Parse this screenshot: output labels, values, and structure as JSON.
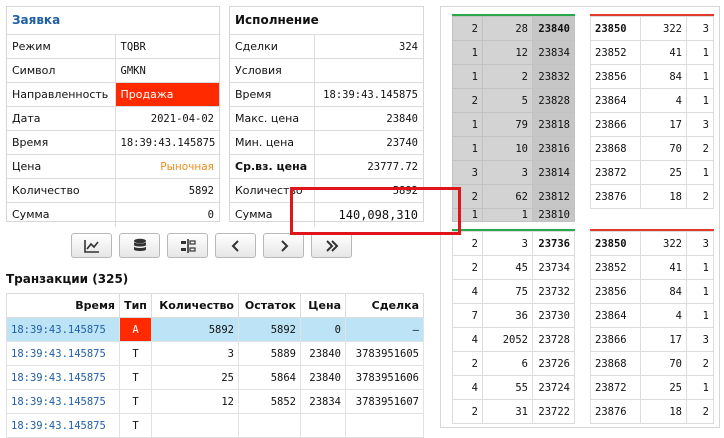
{
  "order": {
    "title": "Заявка",
    "rows": [
      {
        "label": "Режим",
        "value": "TQBR"
      },
      {
        "label": "Символ",
        "value": "GMKN"
      },
      {
        "label": "Направленность",
        "value": "Продажа"
      },
      {
        "label": "Дата",
        "value": "2021-04-02"
      },
      {
        "label": "Время",
        "value": "18:39:43.145875"
      },
      {
        "label": "Цена",
        "value": "Рыночная"
      },
      {
        "label": "Количество",
        "value": "5892"
      },
      {
        "label": "Сумма",
        "value": "0"
      }
    ]
  },
  "execution": {
    "title": "Исполнение",
    "rows": [
      {
        "label": "Сделки",
        "value": "324"
      },
      {
        "label": "Условия",
        "value": ""
      },
      {
        "label": "Время",
        "value": "18:39:43.145875"
      },
      {
        "label": "Макс. цена",
        "value": "23840"
      },
      {
        "label": "Мин. цена",
        "value": "23740"
      },
      {
        "label": "Ср.вз. цена",
        "value": "23777.72"
      },
      {
        "label": "Количество",
        "value": "5892"
      },
      {
        "label": "Сумма",
        "value": "140,098,310"
      }
    ]
  },
  "toolbar": {
    "buttons": [
      {
        "name": "chart-button",
        "icon": "line-chart-icon"
      },
      {
        "name": "database-button",
        "icon": "database-icon"
      },
      {
        "name": "split-button",
        "icon": "split-columns-icon"
      },
      {
        "name": "prev-button",
        "icon": "chevron-left-icon"
      },
      {
        "name": "next-button",
        "icon": "chevron-right-icon"
      },
      {
        "name": "last-button",
        "icon": "double-chevron-right-icon"
      }
    ]
  },
  "transactions": {
    "title": "Транзакции (325)",
    "columns": [
      "Время",
      "Тип",
      "Количество",
      "Остаток",
      "Цена",
      "Сделка"
    ],
    "rows": [
      [
        "18:39:43.145875",
        "A",
        "5892",
        "5892",
        "0",
        "–"
      ],
      [
        "18:39:43.145875",
        "T",
        "3",
        "5889",
        "23840",
        "3783951605"
      ],
      [
        "18:39:43.145875",
        "T",
        "25",
        "5864",
        "23840",
        "3783951606"
      ],
      [
        "18:39:43.145875",
        "T",
        "12",
        "5852",
        "23834",
        "3783951607"
      ],
      [
        "18:39:43.145875",
        "T",
        "",
        "",
        "",
        ""
      ]
    ]
  },
  "book_top_left": {
    "rows": [
      [
        "2",
        "28",
        "23840"
      ],
      [
        "1",
        "12",
        "23834"
      ],
      [
        "1",
        "2",
        "23832"
      ],
      [
        "2",
        "5",
        "23828"
      ],
      [
        "1",
        "79",
        "23818"
      ],
      [
        "1",
        "10",
        "23816"
      ],
      [
        "3",
        "3",
        "23814"
      ],
      [
        "2",
        "62",
        "23812"
      ],
      [
        "1",
        "1",
        "23810"
      ]
    ]
  },
  "book_top_right": {
    "rows": [
      [
        "23850",
        "322",
        "3"
      ],
      [
        "23852",
        "41",
        "1"
      ],
      [
        "23856",
        "84",
        "1"
      ],
      [
        "23864",
        "4",
        "1"
      ],
      [
        "23866",
        "17",
        "3"
      ],
      [
        "23868",
        "70",
        "2"
      ],
      [
        "23872",
        "25",
        "1"
      ],
      [
        "23876",
        "18",
        "2"
      ]
    ]
  },
  "book_bottom_left": {
    "rows": [
      [
        "2",
        "3",
        "23736"
      ],
      [
        "2",
        "45",
        "23734"
      ],
      [
        "4",
        "75",
        "23732"
      ],
      [
        "7",
        "36",
        "23730"
      ],
      [
        "4",
        "2052",
        "23728"
      ],
      [
        "2",
        "6",
        "23726"
      ],
      [
        "4",
        "55",
        "23724"
      ],
      [
        "2",
        "31",
        "23722"
      ]
    ]
  },
  "book_bottom_right": {
    "rows": [
      [
        "23850",
        "322",
        "3"
      ],
      [
        "23852",
        "41",
        "1"
      ],
      [
        "23856",
        "84",
        "1"
      ],
      [
        "23864",
        "4",
        "1"
      ],
      [
        "23866",
        "17",
        "3"
      ],
      [
        "23868",
        "70",
        "2"
      ],
      [
        "23872",
        "25",
        "1"
      ],
      [
        "23876",
        "18",
        "2"
      ]
    ]
  },
  "colors": {
    "sell": "#ff2a00",
    "link_blue": "#1f5fa8",
    "market_orange": "#f08c1a",
    "selected_row": "#bde3f6",
    "highlight_red": "#e0141b",
    "bid_line": "#2aa84a",
    "ask_line": "#e23a2a"
  }
}
